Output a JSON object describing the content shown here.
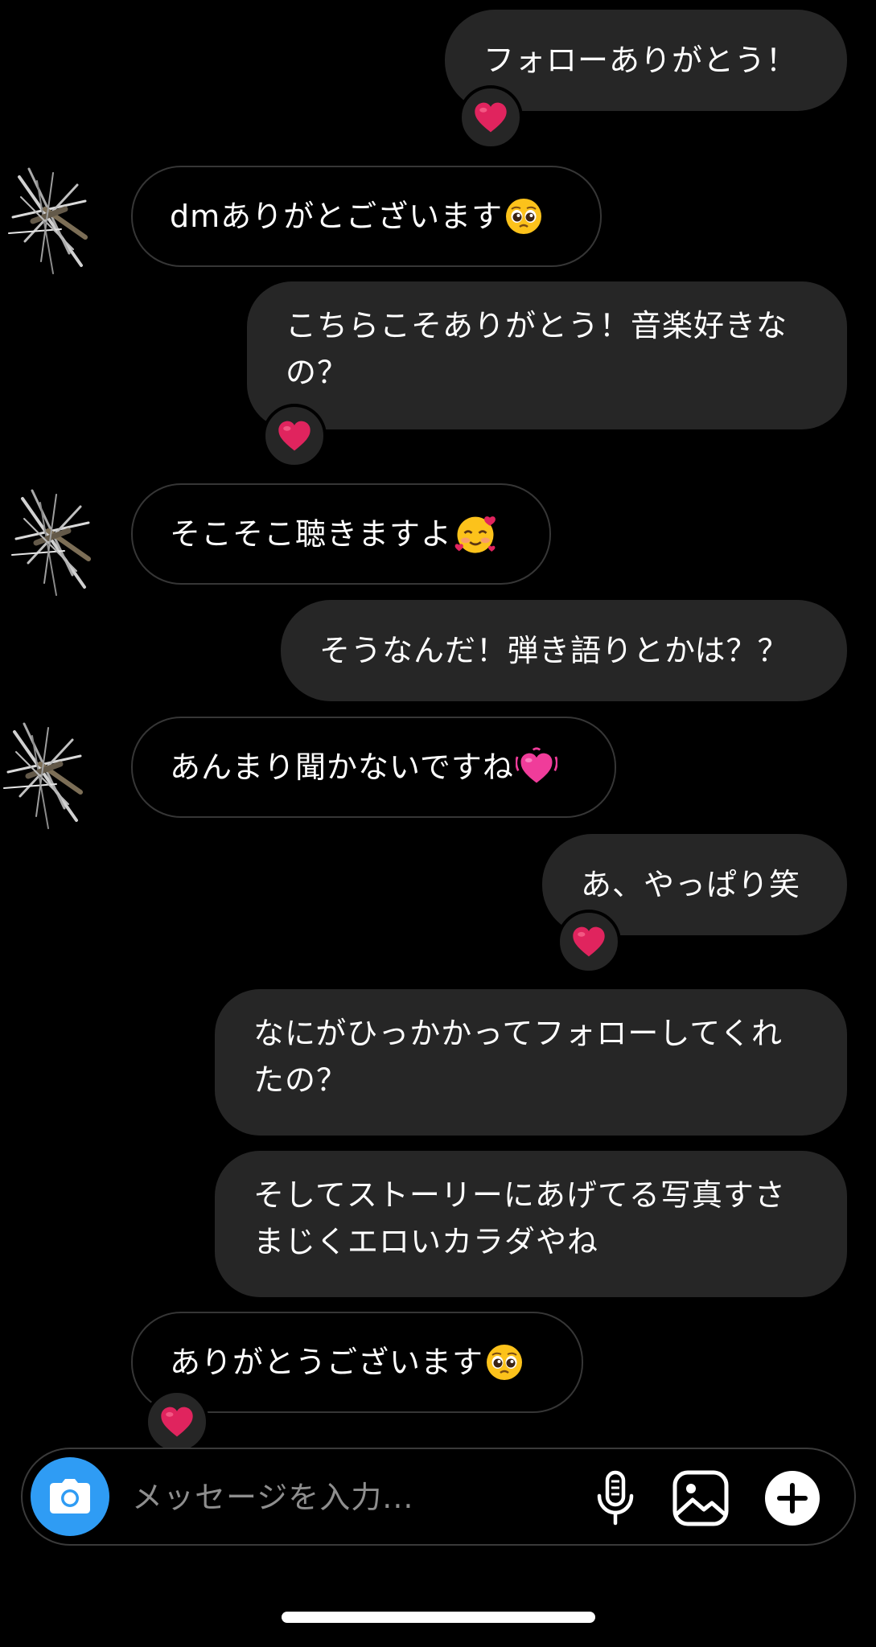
{
  "messages": [
    {
      "side": "out",
      "text": "フォローありがとう！",
      "reaction": "heart"
    },
    {
      "side": "in",
      "text": "dmありがとございます",
      "emoji": "pleading-face"
    },
    {
      "side": "out",
      "line1": "こちらこそありがとう！音楽好きな",
      "line2": "の？",
      "reaction": "heart"
    },
    {
      "side": "in",
      "text": "そこそこ聴きますよ",
      "emoji": "smiling-face-with-hearts"
    },
    {
      "side": "out",
      "text": "そうなんだ！弾き語りとかは？？"
    },
    {
      "side": "in",
      "text": "あんまり聞かないですね",
      "emoji": "beating-heart"
    },
    {
      "side": "out",
      "text": "あ、やっぱり笑",
      "reaction": "heart"
    },
    {
      "side": "out",
      "line1": "なにがひっかかってフォローしてくれ",
      "line2": "たの？"
    },
    {
      "side": "out",
      "line1": "そしてストーリーにあげてる写真すさ",
      "line2": "まじくエロいカラダやね"
    },
    {
      "side": "in",
      "text": "ありがとうございます",
      "emoji": "pleading-face",
      "reaction": "heart"
    }
  ],
  "composer": {
    "placeholder": "メッセージを入力...",
    "icons": [
      "camera-icon",
      "microphone-icon",
      "gallery-icon",
      "plus-icon"
    ]
  },
  "colors": {
    "background": "#000000",
    "outgoing_bubble": "#262626",
    "incoming_border": "#363636",
    "camera_button": "#2f9cf4",
    "heart": "#e0245e"
  }
}
